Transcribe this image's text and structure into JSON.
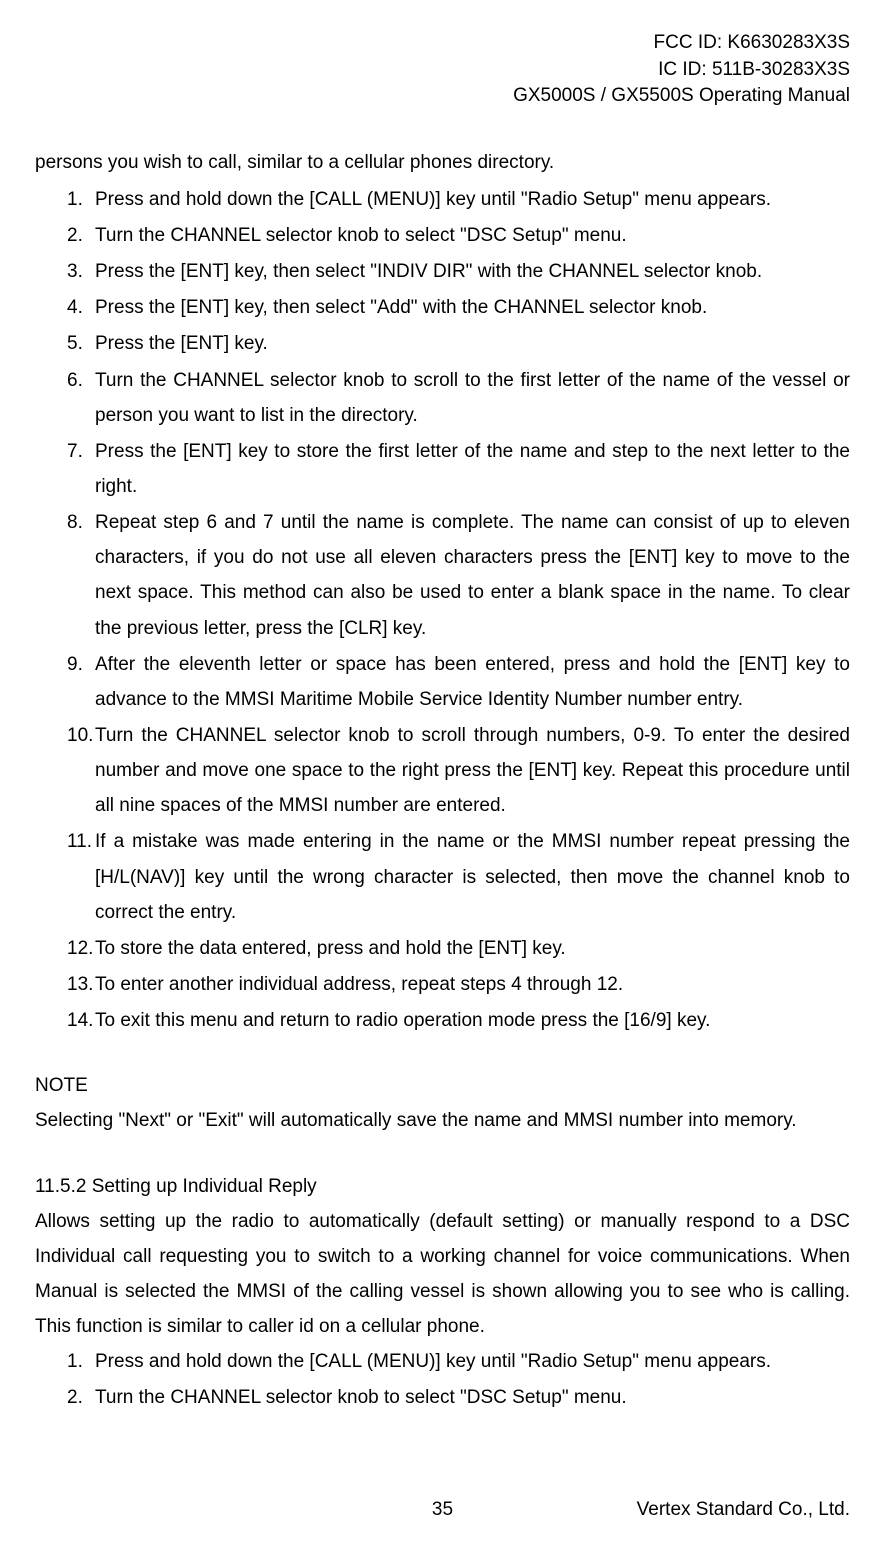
{
  "header": {
    "fcc": "FCC ID: K6630283X3S",
    "ic": "IC ID: 511B-30283X3S",
    "model": "GX5000S / GX5500S  Operating Manual"
  },
  "intro": "persons you wish to call, similar to a cellular phones directory.",
  "steps": [
    {
      "n": "1.",
      "t": "Press and hold down the [CALL (MENU)] key until \"Radio Setup\" menu appears."
    },
    {
      "n": "2.",
      "t": "Turn the CHANNEL selector knob to select \"DSC Setup\" menu."
    },
    {
      "n": "3.",
      "t": "Press the [ENT] key, then select \"INDIV DIR\" with the CHANNEL selector knob."
    },
    {
      "n": "4.",
      "t": "Press the [ENT] key, then select \"Add\" with the CHANNEL selector knob."
    },
    {
      "n": "5.",
      "t": "Press the [ENT] key."
    },
    {
      "n": "6.",
      "t": "Turn the CHANNEL selector knob to scroll to the first letter of the name of the vessel or person you want to list in the directory."
    },
    {
      "n": "7.",
      "t": "Press the [ENT] key to store the first letter of the name and step to the next letter to the right."
    },
    {
      "n": "8.",
      "t": "Repeat step 6 and 7 until the name is complete. The name can consist of up to eleven characters, if you do not use all eleven characters press the [ENT] key to move to the next space. This method can also be used to enter a blank space in the name. To clear the previous letter, press the [CLR] key."
    },
    {
      "n": "9.",
      "t": "After the eleventh letter or space has been entered, press and hold the [ENT] key to advance to the MMSI Maritime Mobile Service Identity Number number entry."
    },
    {
      "n": "10.",
      "t": "Turn the CHANNEL selector knob to scroll through numbers, 0-9. To enter the desired number and move one space to the right press the [ENT] key. Repeat this procedure until all nine spaces of the MMSI number are entered."
    },
    {
      "n": "11.",
      "t": "If a mistake was made entering in the name or the MMSI number repeat pressing the [H/L(NAV)] key until the wrong character is selected, then move the channel knob to correct the entry."
    },
    {
      "n": "12.",
      "t": "To store the data entered, press and hold the [ENT] key."
    },
    {
      "n": "13.",
      "t": "To enter another individual address, repeat steps 4 through 12."
    },
    {
      "n": "14.",
      "t": "To exit this menu and return to radio operation mode press the [16/9] key."
    }
  ],
  "note": {
    "heading": "NOTE",
    "text": "Selecting \"Next\" or \"Exit\" will automatically save the name and MMSI number into memory."
  },
  "section2": {
    "heading": "11.5.2 Setting up Individual Reply",
    "text": "Allows setting up the radio to automatically (default setting) or manually respond to a DSC Individual call requesting you to switch to a working channel for voice communications. When Manual is selected the MMSI of the calling vessel is shown allowing you to see who is calling. This function is similar to caller id on a cellular phone."
  },
  "steps2": [
    {
      "n": "1.",
      "t": "Press and hold down the [CALL (MENU)] key until \"Radio Setup\" menu appears."
    },
    {
      "n": "2.",
      "t": "Turn the CHANNEL selector knob to select \"DSC Setup\" menu."
    }
  ],
  "footer": {
    "page": "35",
    "company": "Vertex Standard Co., Ltd."
  }
}
